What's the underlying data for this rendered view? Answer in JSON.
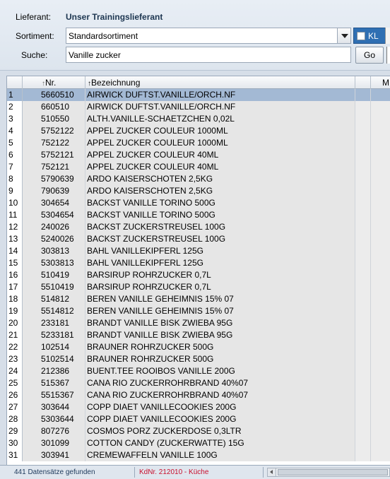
{
  "form": {
    "supplier_label": "Lieferant:",
    "supplier_value": "Unser Trainingslieferant",
    "assortment_label": "Sortiment:",
    "assortment_value": "Standardsortiment",
    "kl_label": "KL",
    "search_label": "Suche:",
    "search_value": "Vanille zucker",
    "go_label": "Go"
  },
  "grid": {
    "col_nr": "Nr.",
    "col_bez": "Bezeichnung",
    "col_extra": "M",
    "selected_row": 1,
    "rows": [
      {
        "idx": "1",
        "nr": "5660510",
        "bez": "AIRWICK DUFTST.VANILLE/ORCH.NF"
      },
      {
        "idx": "2",
        "nr": "660510",
        "bez": "AIRWICK DUFTST.VANILLE/ORCH.NF"
      },
      {
        "idx": "3",
        "nr": "510550",
        "bez": "ALTH.VANILLE-SCHAETZCHEN 0,02L"
      },
      {
        "idx": "4",
        "nr": "5752122",
        "bez": "APPEL ZUCKER COULEUR 1000ML"
      },
      {
        "idx": "5",
        "nr": "752122",
        "bez": "APPEL ZUCKER COULEUR 1000ML"
      },
      {
        "idx": "6",
        "nr": "5752121",
        "bez": "APPEL ZUCKER COULEUR 40ML"
      },
      {
        "idx": "7",
        "nr": "752121",
        "bez": "APPEL ZUCKER COULEUR 40ML"
      },
      {
        "idx": "8",
        "nr": "5790639",
        "bez": "ARDO KAISERSCHOTEN 2,5KG"
      },
      {
        "idx": "9",
        "nr": "790639",
        "bez": "ARDO KAISERSCHOTEN 2,5KG"
      },
      {
        "idx": "10",
        "nr": "304654",
        "bez": "BACKST VANILLE TORINO 500G"
      },
      {
        "idx": "11",
        "nr": "5304654",
        "bez": "BACKST VANILLE TORINO 500G"
      },
      {
        "idx": "12",
        "nr": "240026",
        "bez": "BACKST ZUCKERSTREUSEL 100G"
      },
      {
        "idx": "13",
        "nr": "5240026",
        "bez": "BACKST ZUCKERSTREUSEL 100G"
      },
      {
        "idx": "14",
        "nr": "303813",
        "bez": "BAHL VANILLEKIPFERL 125G"
      },
      {
        "idx": "15",
        "nr": "5303813",
        "bez": "BAHL VANILLEKIPFERL 125G"
      },
      {
        "idx": "16",
        "nr": "510419",
        "bez": "BARSIRUP ROHRZUCKER 0,7L"
      },
      {
        "idx": "17",
        "nr": "5510419",
        "bez": "BARSIRUP ROHRZUCKER 0,7L"
      },
      {
        "idx": "18",
        "nr": "514812",
        "bez": "BEREN VANILLE GEHEIMNIS 15% 07"
      },
      {
        "idx": "19",
        "nr": "5514812",
        "bez": "BEREN VANILLE GEHEIMNIS 15% 07"
      },
      {
        "idx": "20",
        "nr": "233181",
        "bez": "BRANDT VANILLE BISK ZWIEBA 95G"
      },
      {
        "idx": "21",
        "nr": "5233181",
        "bez": "BRANDT VANILLE BISK ZWIEBA 95G"
      },
      {
        "idx": "22",
        "nr": "102514",
        "bez": "BRAUNER ROHRZUCKER 500G"
      },
      {
        "idx": "23",
        "nr": "5102514",
        "bez": "BRAUNER ROHRZUCKER 500G"
      },
      {
        "idx": "24",
        "nr": "212386",
        "bez": "BUENT.TEE ROOIBOS VANILLE 200G"
      },
      {
        "idx": "25",
        "nr": "515367",
        "bez": "CANA RIO ZUCKERROHRBRAND 40%07"
      },
      {
        "idx": "26",
        "nr": "5515367",
        "bez": "CANA RIO ZUCKERROHRBRAND 40%07"
      },
      {
        "idx": "27",
        "nr": "303644",
        "bez": "COPP DIAET VANILLECOOKIES 200G"
      },
      {
        "idx": "28",
        "nr": "5303644",
        "bez": "COPP DIAET VANILLECOOKIES 200G"
      },
      {
        "idx": "29",
        "nr": "807276",
        "bez": "COSMOS PORZ ZUCKERDOSE 0,3LTR"
      },
      {
        "idx": "30",
        "nr": "301099",
        "bez": "COTTON CANDY (ZUCKERWATTE) 15G"
      },
      {
        "idx": "31",
        "nr": "303941",
        "bez": "CREMEWAFFELN VANILLE 100G"
      }
    ]
  },
  "status": {
    "count_text": "441 Datensätze gefunden",
    "kd_text": "KdNr. 212010 - Küche"
  },
  "colors": {
    "selection": "#a3b9d4",
    "kl_accent": "#2f6fb3",
    "status_red": "#c8102e"
  }
}
